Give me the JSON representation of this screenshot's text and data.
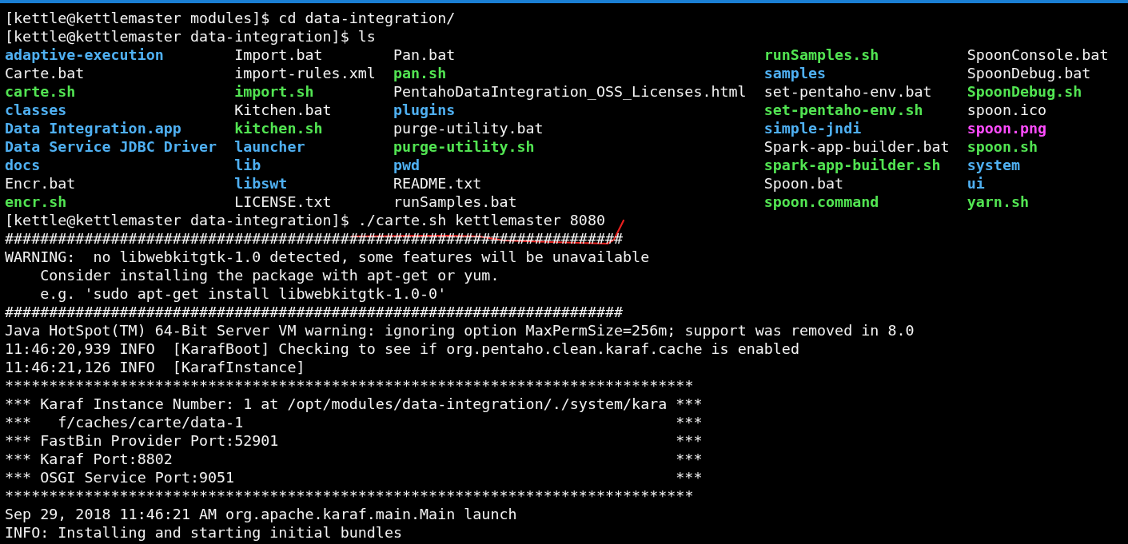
{
  "terminal": {
    "lines_before": [
      {
        "kind": "text",
        "text": "[kettle@kettlemaster modules]$ cd data-integration/"
      },
      {
        "kind": "text",
        "text": "[kettle@kettlemaster data-integration]$ ls"
      }
    ],
    "listing": {
      "columns": [
        [
          {
            "name": "adaptive-execution",
            "kind": "dir"
          },
          {
            "name": "Carte.bat",
            "kind": "file"
          },
          {
            "name": "carte.sh",
            "kind": "exec"
          },
          {
            "name": "classes",
            "kind": "dir"
          },
          {
            "name": "Data Integration.app",
            "kind": "dir"
          },
          {
            "name": "Data Service JDBC Driver",
            "kind": "dir"
          },
          {
            "name": "docs",
            "kind": "dir"
          },
          {
            "name": "Encr.bat",
            "kind": "file"
          },
          {
            "name": "encr.sh",
            "kind": "exec"
          }
        ],
        [
          {
            "name": "Import.bat",
            "kind": "file"
          },
          {
            "name": "import-rules.xml",
            "kind": "file"
          },
          {
            "name": "import.sh",
            "kind": "exec"
          },
          {
            "name": "Kitchen.bat",
            "kind": "file"
          },
          {
            "name": "kitchen.sh",
            "kind": "exec"
          },
          {
            "name": "launcher",
            "kind": "dir"
          },
          {
            "name": "lib",
            "kind": "dir"
          },
          {
            "name": "libswt",
            "kind": "dir"
          },
          {
            "name": "LICENSE.txt",
            "kind": "file"
          }
        ],
        [
          {
            "name": "Pan.bat",
            "kind": "file"
          },
          {
            "name": "pan.sh",
            "kind": "exec"
          },
          {
            "name": "PentahoDataIntegration_OSS_Licenses.html",
            "kind": "file"
          },
          {
            "name": "plugins",
            "kind": "dir"
          },
          {
            "name": "purge-utility.bat",
            "kind": "file"
          },
          {
            "name": "purge-utility.sh",
            "kind": "exec"
          },
          {
            "name": "pwd",
            "kind": "dir"
          },
          {
            "name": "README.txt",
            "kind": "file"
          },
          {
            "name": "runSamples.bat",
            "kind": "file"
          }
        ],
        [
          {
            "name": "runSamples.sh",
            "kind": "exec"
          },
          {
            "name": "samples",
            "kind": "dir"
          },
          {
            "name": "set-pentaho-env.bat",
            "kind": "file"
          },
          {
            "name": "set-pentaho-env.sh",
            "kind": "exec"
          },
          {
            "name": "simple-jndi",
            "kind": "dir"
          },
          {
            "name": "Spark-app-builder.bat",
            "kind": "file"
          },
          {
            "name": "spark-app-builder.sh",
            "kind": "exec"
          },
          {
            "name": "Spoon.bat",
            "kind": "file"
          },
          {
            "name": "spoon.command",
            "kind": "exec"
          }
        ],
        [
          {
            "name": "SpoonConsole.bat",
            "kind": "file"
          },
          {
            "name": "SpoonDebug.bat",
            "kind": "file"
          },
          {
            "name": "SpoonDebug.sh",
            "kind": "exec"
          },
          {
            "name": "spoon.ico",
            "kind": "file"
          },
          {
            "name": "spoon.png",
            "kind": "image"
          },
          {
            "name": "spoon.sh",
            "kind": "exec"
          },
          {
            "name": "system",
            "kind": "dir"
          },
          {
            "name": "ui",
            "kind": "dir"
          },
          {
            "name": "yarn.sh",
            "kind": "exec"
          }
        ]
      ]
    },
    "lines_after": [
      {
        "kind": "text",
        "text": "[kettle@kettlemaster data-integration]$ ./carte.sh kettlemaster 8080"
      },
      {
        "kind": "text",
        "text": "######################################################################"
      },
      {
        "kind": "text",
        "text": "WARNING:  no libwebkitgtk-1.0 detected, some features will be unavailable"
      },
      {
        "kind": "text",
        "text": "    Consider installing the package with apt-get or yum."
      },
      {
        "kind": "text",
        "text": "    e.g. 'sudo apt-get install libwebkitgtk-1.0-0'"
      },
      {
        "kind": "text",
        "text": "######################################################################"
      },
      {
        "kind": "text",
        "text": "Java HotSpot(TM) 64-Bit Server VM warning: ignoring option MaxPermSize=256m; support was removed in 8.0"
      },
      {
        "kind": "text",
        "text": "11:46:20,939 INFO  [KarafBoot] Checking to see if org.pentaho.clean.karaf.cache is enabled"
      },
      {
        "kind": "text",
        "text": "11:46:21,126 INFO  [KarafInstance]"
      },
      {
        "kind": "text",
        "text": "******************************************************************************"
      },
      {
        "kind": "boxed",
        "left": "*** Karaf Instance Number: 1 at /opt/modules/data-integration/./system/kara",
        "right": "***"
      },
      {
        "kind": "boxed",
        "left": "***   f/caches/carte/data-1",
        "right": "***"
      },
      {
        "kind": "boxed",
        "left": "*** FastBin Provider Port:52901",
        "right": "***"
      },
      {
        "kind": "boxed",
        "left": "*** Karaf Port:8802",
        "right": "***"
      },
      {
        "kind": "boxed",
        "left": "*** OSGI Service Port:9051",
        "right": "***"
      },
      {
        "kind": "text",
        "text": "******************************************************************************"
      },
      {
        "kind": "text",
        "text": "Sep 29, 2018 11:46:21 AM org.apache.karaf.main.Main launch"
      },
      {
        "kind": "text",
        "text": "INFO: Installing and starting initial bundles"
      }
    ]
  }
}
